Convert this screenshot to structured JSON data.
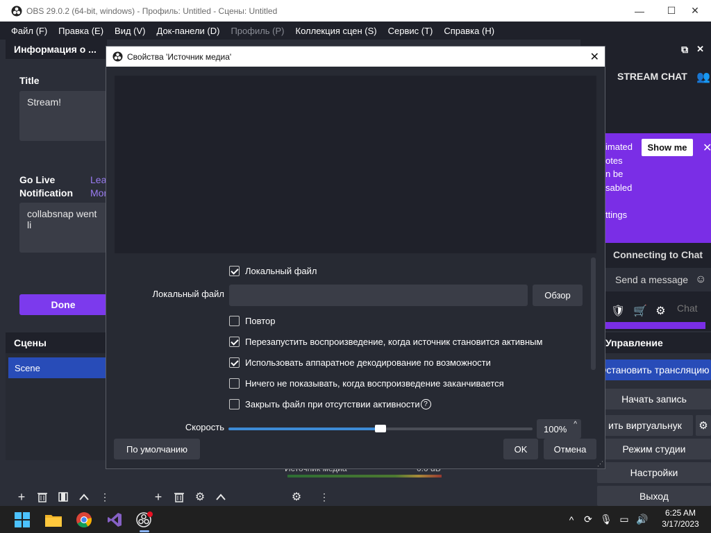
{
  "window": {
    "title": "OBS 29.0.2 (64-bit, windows) - Профиль: Untitled - Сцены: Untitled",
    "minimize_glyph": "—",
    "maximize_glyph": "☐",
    "close_glyph": "✕"
  },
  "menu": [
    {
      "label": "Файл (F)",
      "enabled": true
    },
    {
      "label": "Правка (E)",
      "enabled": true
    },
    {
      "label": "Вид (V)",
      "enabled": true
    },
    {
      "label": "Док-панели (D)",
      "enabled": true
    },
    {
      "label": "Профиль (P)",
      "enabled": false
    },
    {
      "label": "Коллекция сцен (S)",
      "enabled": true
    },
    {
      "label": "Сервис (T)",
      "enabled": true
    },
    {
      "label": "Справка (H)",
      "enabled": true
    }
  ],
  "info_dock": {
    "header": "Информация о ...",
    "title_label": "Title",
    "title_value": "Stream!",
    "golive_label_1": "Go Live",
    "golive_label_2": "Notification",
    "link_1": "Lea",
    "link_2": "Mor",
    "notification_value": "collabsnap went li",
    "done_button": "Done"
  },
  "scenes_dock": {
    "header": "Сцены",
    "items": [
      "Scene"
    ]
  },
  "chat_dock": {
    "stream_chat": "STREAM CHAT",
    "promo_lines": [
      "imated",
      "otes",
      "n be",
      "sabled",
      "",
      "ttings"
    ],
    "show_me": "Show me",
    "connecting": "Connecting to Chat",
    "send_message": "Send a message",
    "chat_button": "Chat"
  },
  "controls_dock": {
    "header": "Управление",
    "buttons": [
      {
        "label": "Остановить трансляцию",
        "primary": true
      },
      {
        "label": "Начать запись",
        "primary": false
      },
      {
        "label": "ить виртуальнук",
        "primary": false
      },
      {
        "label": "Режим студии",
        "primary": false
      },
      {
        "label": "Настройки",
        "primary": false
      },
      {
        "label": "Выход",
        "primary": false
      }
    ]
  },
  "mixer": {
    "source": "Источник медиа",
    "db": "0.0 dB"
  },
  "dialog": {
    "title": "Свойства 'Источник медиа'",
    "local_file_checkbox": {
      "label": "Локальный файл",
      "checked": true
    },
    "local_file_label": "Локальный файл",
    "local_file_value": "",
    "browse_button": "Обзор",
    "checkboxes": [
      {
        "label": "Повтор",
        "checked": false
      },
      {
        "label": "Перезапустить воспроизведение, когда источник становится активным",
        "checked": true
      },
      {
        "label": "Использовать аппаратное декодирование по возможности",
        "checked": true
      },
      {
        "label": "Ничего не показывать, когда воспроизведение заканчивается",
        "checked": false
      },
      {
        "label": "Закрыть файл при отсутствии активности",
        "checked": false,
        "help": true
      }
    ],
    "speed_label": "Скорость",
    "speed_value": "100%",
    "speed_fraction": 0.5,
    "defaults_button": "По умолчанию",
    "ok_button": "OK",
    "cancel_button": "Отмена"
  },
  "taskbar": {
    "time": "6:25 AM",
    "date": "3/17/2023"
  }
}
